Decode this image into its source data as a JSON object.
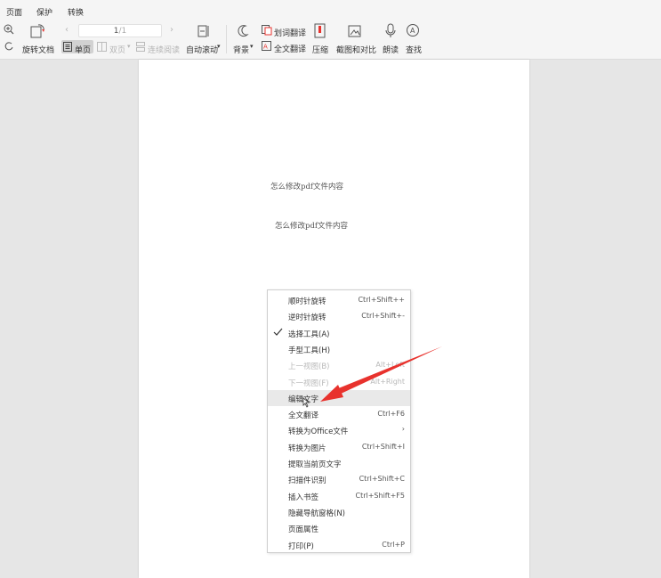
{
  "menu_tabs": [
    "页面",
    "保护",
    "转换"
  ],
  "toolbar": {
    "rotate_doc": "旋转文档",
    "single_page": "单页",
    "double_page": "双页",
    "continuous": "连续阅读",
    "page_current": "1",
    "page_total": "/1",
    "auto_scroll": "自动滚动",
    "background": "背景",
    "word_translate": "划词翻译",
    "full_translate": "全文翻译",
    "compress": "压缩",
    "screenshot_compare": "截图和对比",
    "read_aloud": "朗读",
    "find": "查找"
  },
  "document": {
    "line1": "怎么修改pdf文件内容",
    "line2": "怎么修改pdf文件内容"
  },
  "context_menu": [
    {
      "label": "顺时针旋转",
      "shortcut": "Ctrl+Shift++",
      "disabled": false
    },
    {
      "label": "逆时针旋转",
      "shortcut": "Ctrl+Shift+-",
      "disabled": false
    },
    {
      "label": "选择工具(A)",
      "shortcut": "",
      "checked": true,
      "disabled": false
    },
    {
      "label": "手型工具(H)",
      "shortcut": "",
      "disabled": false
    },
    {
      "label": "上一视图(B)",
      "shortcut": "Alt+Left",
      "disabled": true
    },
    {
      "label": "下一视图(F)",
      "shortcut": "Alt+Right",
      "disabled": true
    },
    {
      "label": "编辑文字",
      "shortcut": "",
      "highlighted": true,
      "disabled": false
    },
    {
      "label": "全文翻译",
      "shortcut": "Ctrl+F6",
      "disabled": false
    },
    {
      "label": "转换为Office文件",
      "shortcut": "",
      "submenu": true,
      "disabled": false
    },
    {
      "label": "转换为图片",
      "shortcut": "Ctrl+Shift+I",
      "disabled": false
    },
    {
      "label": "提取当前页文字",
      "shortcut": "",
      "disabled": false
    },
    {
      "label": "扫描件识别",
      "shortcut": "Ctrl+Shift+C",
      "disabled": false
    },
    {
      "label": "插入书签",
      "shortcut": "Ctrl+Shift+F5",
      "disabled": false
    },
    {
      "label": "隐藏导航窗格(N)",
      "shortcut": "",
      "disabled": false
    },
    {
      "label": "页面属性",
      "shortcut": "",
      "disabled": false
    },
    {
      "label": "打印(P)",
      "shortcut": "Ctrl+P",
      "disabled": false
    }
  ],
  "colors": {
    "annotation_arrow": "#e8322d",
    "highlight": "#e9e9e9",
    "disabled_text": "#b9b9b9"
  }
}
